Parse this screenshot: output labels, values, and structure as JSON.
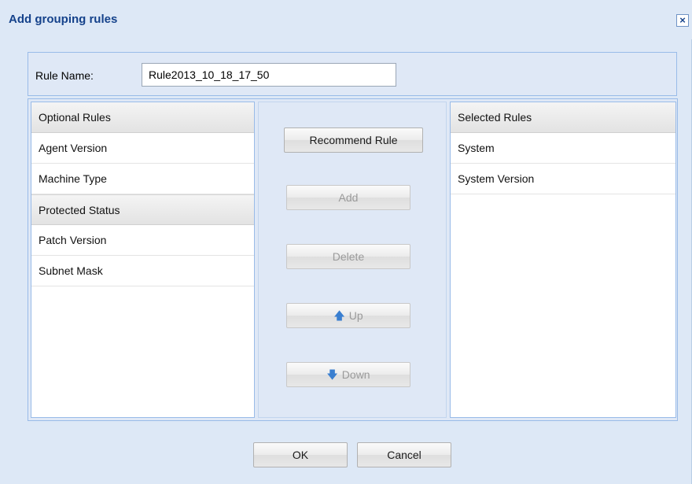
{
  "dialog": {
    "title": "Add grouping rules",
    "close_glyph": "×"
  },
  "rule_name": {
    "label": "Rule Name:",
    "value": "Rule2013_10_18_17_50"
  },
  "optional_rules": {
    "header": "Optional Rules",
    "items": [
      {
        "label": "Agent Version"
      },
      {
        "label": "Machine Type"
      },
      {
        "label": "Protected Status",
        "selected": true
      },
      {
        "label": "Patch Version"
      },
      {
        "label": "Subnet Mask"
      }
    ]
  },
  "selected_rules": {
    "header": "Selected Rules",
    "items": [
      {
        "label": "System"
      },
      {
        "label": "System Version"
      }
    ]
  },
  "actions": {
    "recommend": "Recommend Rule",
    "add": "Add",
    "delete": "Delete",
    "up": "Up",
    "down": "Down",
    "up_icon": "up-arrow-icon",
    "down_icon": "down-arrow-icon"
  },
  "footer": {
    "ok": "OK",
    "cancel": "Cancel"
  },
  "colors": {
    "title": "#15428b",
    "panel_bg": "#dfe8f6",
    "border": "#99bbe8",
    "arrow": "#3a7fd0"
  }
}
